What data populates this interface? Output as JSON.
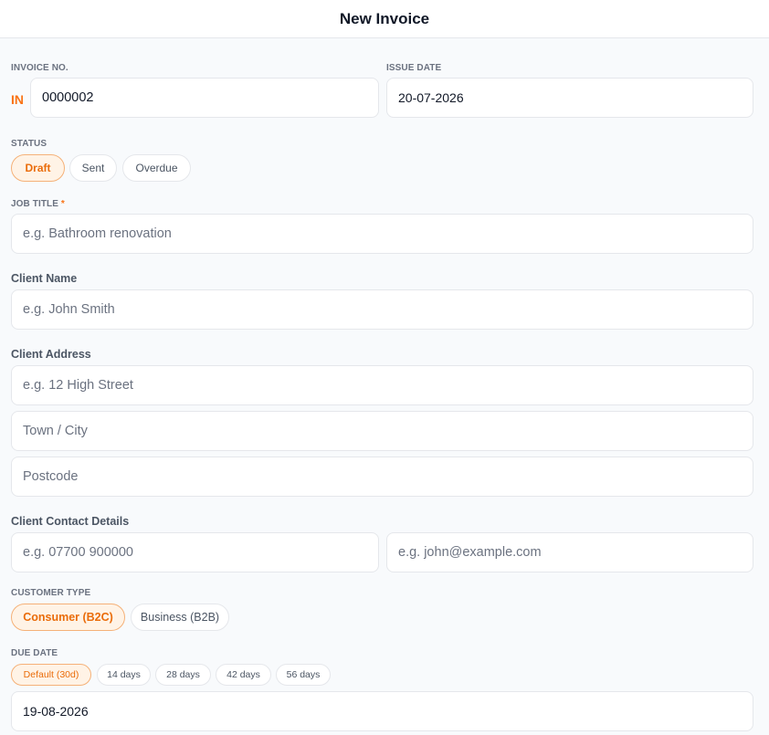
{
  "header": {
    "title": "New Invoice"
  },
  "invoice_no": {
    "label": "INVOICE NO.",
    "prefix": "IN",
    "value": "0000002"
  },
  "issue_date": {
    "label": "ISSUE DATE",
    "value": "20-07-2026"
  },
  "status": {
    "label": "STATUS",
    "options": [
      "Draft",
      "Sent",
      "Overdue"
    ],
    "selected": "Draft"
  },
  "job_title": {
    "label": "JOB TITLE",
    "required_mark": "*",
    "placeholder": "e.g. Bathroom renovation"
  },
  "client_name": {
    "label": "Client Name",
    "placeholder": "e.g. John Smith"
  },
  "client_address": {
    "label": "Client Address",
    "street_placeholder": "e.g. 12 High Street",
    "town_placeholder": "Town / City",
    "postcode_placeholder": "Postcode"
  },
  "client_contact": {
    "label": "Client Contact Details",
    "phone_placeholder": "e.g. 07700 900000",
    "email_placeholder": "e.g. john@example.com"
  },
  "customer_type": {
    "label": "CUSTOMER TYPE",
    "options": [
      "Consumer (B2C)",
      "Business (B2B)"
    ],
    "selected": "Consumer (B2C)"
  },
  "due_date": {
    "label": "DUE DATE",
    "options": [
      "Default (30d)",
      "14 days",
      "28 days",
      "42 days",
      "56 days"
    ],
    "selected": "Default (30d)",
    "value": "19-08-2026"
  },
  "colors": {
    "accent": "#f97316",
    "accent_bg": "#fff3e6",
    "border": "#e5e7eb",
    "background": "#f8fafc"
  }
}
